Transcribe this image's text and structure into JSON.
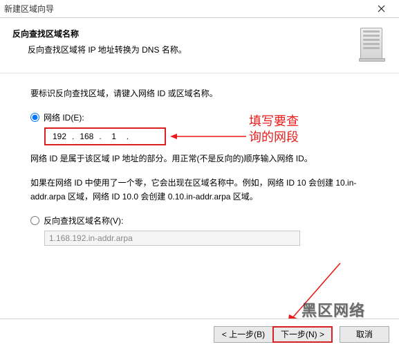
{
  "window": {
    "title": "新建区域向导"
  },
  "header": {
    "title": "反向查找区域名称",
    "subtitle": "反向查找区域将 IP 地址转换为 DNS 名称。"
  },
  "content": {
    "intro": "要标识反向查找区域，请键入网络 ID 或区域名称。",
    "radio_network_id_label": "网络 ID(E):",
    "network_id": {
      "o1": "192",
      "o2": "168",
      "o3": "1",
      "o4": ""
    },
    "network_id_help": "网络 ID 是属于该区域 IP 地址的部分。用正常(不是反向的)顺序输入网络 ID。",
    "example_text": "如果在网络 ID 中使用了一个零，它会出现在区域名称中。例如，网络 ID 10 会创建 10.in-addr.arpa 区域，网络 ID 10.0 会创建 0.10.in-addr.arpa 区域。",
    "radio_zone_name_label": "反向查找区域名称(V):",
    "zone_name_value": "1.168.192.in-addr.arpa"
  },
  "annotation": {
    "line1": "填写要查",
    "line2": "询的网段"
  },
  "watermark": {
    "text": "黑区网络"
  },
  "footer": {
    "back": "< 上一步(B)",
    "next": "下一步(N) >",
    "cancel": "取消"
  }
}
